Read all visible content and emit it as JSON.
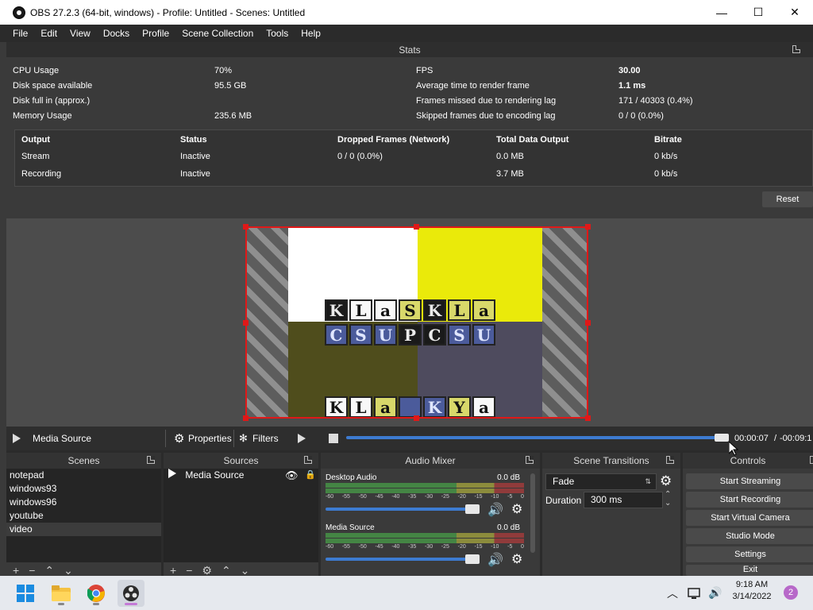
{
  "window": {
    "title": "OBS 27.2.3 (64-bit, windows) - Profile: Untitled - Scenes: Untitled",
    "controls": {
      "minimize": "—",
      "maximize": "☐",
      "close": "✕"
    }
  },
  "menu": [
    "File",
    "Edit",
    "View",
    "Docks",
    "Profile",
    "Scene Collection",
    "Tools",
    "Help"
  ],
  "stats": {
    "title": "Stats",
    "left": [
      {
        "label": "CPU Usage",
        "value": "70%"
      },
      {
        "label": "Disk space available",
        "value": "95.5 GB"
      },
      {
        "label": "Disk full in (approx.)",
        "value": ""
      },
      {
        "label": "Memory Usage",
        "value": "235.6 MB"
      }
    ],
    "right": [
      {
        "label": "FPS",
        "value": "30.00"
      },
      {
        "label": "Average time to render frame",
        "value": "1.1 ms"
      },
      {
        "label": "Frames missed due to rendering lag",
        "value": "171 / 40303 (0.4%)"
      },
      {
        "label": "Skipped frames due to encoding lag",
        "value": "0 / 0 (0.0%)"
      }
    ],
    "output_headers": [
      "Output",
      "Status",
      "Dropped Frames (Network)",
      "Total Data Output",
      "Bitrate"
    ],
    "output_rows": [
      [
        "Stream",
        "Inactive",
        "0 / 0 (0.0%)",
        "0.0 MB",
        "0 kb/s"
      ],
      [
        "Recording",
        "Inactive",
        "",
        "3.7 MB",
        "0 kb/s"
      ]
    ],
    "reset_label": "Reset"
  },
  "preview": {
    "glyph_rows": [
      [
        "K",
        "L",
        "a",
        "S",
        "K",
        "L",
        "a"
      ],
      [
        "C",
        "S",
        "U",
        "P",
        "C",
        "S",
        "U"
      ],
      [
        "K",
        "L",
        "a",
        "",
        "K",
        "Y",
        "a"
      ]
    ]
  },
  "media_controls": {
    "source_name": "Media Source",
    "properties_label": "Properties",
    "filters_label": "Filters",
    "time_current": "00:00:07",
    "time_separator": "/",
    "time_remaining": "-00:09:1",
    "progress": 0.99
  },
  "scenes": {
    "title": "Scenes",
    "items": [
      "notepad",
      "windows93",
      "windows96",
      "youtube",
      "video"
    ],
    "selected": "video"
  },
  "sources": {
    "title": "Sources",
    "items": [
      {
        "name": "Media Source",
        "visible": true,
        "locked": false
      }
    ]
  },
  "audio_mixer": {
    "title": "Audio Mixer",
    "ticks": [
      "-60",
      "-55",
      "-50",
      "-45",
      "-40",
      "-35",
      "-30",
      "-25",
      "-20",
      "-15",
      "-10",
      "-5",
      "0"
    ],
    "channels": [
      {
        "name": "Desktop Audio",
        "db": "0.0 dB",
        "volume": 0.94
      },
      {
        "name": "Media Source",
        "db": "0.0 dB",
        "volume": 0.94
      }
    ]
  },
  "scene_transitions": {
    "title": "Scene Transitions",
    "transition": "Fade",
    "duration_label": "Duration",
    "duration_value": "300 ms"
  },
  "controls": {
    "title": "Controls",
    "buttons": [
      "Start Streaming",
      "Start Recording",
      "Start Virtual Camera",
      "Studio Mode",
      "Settings",
      "Exit"
    ]
  },
  "taskbar": {
    "apps": [
      "start-icon",
      "file-explorer-icon",
      "chrome-icon",
      "obs-icon"
    ],
    "tray_time": "9:18 AM",
    "tray_date": "3/14/2022",
    "notification_count": "2"
  }
}
